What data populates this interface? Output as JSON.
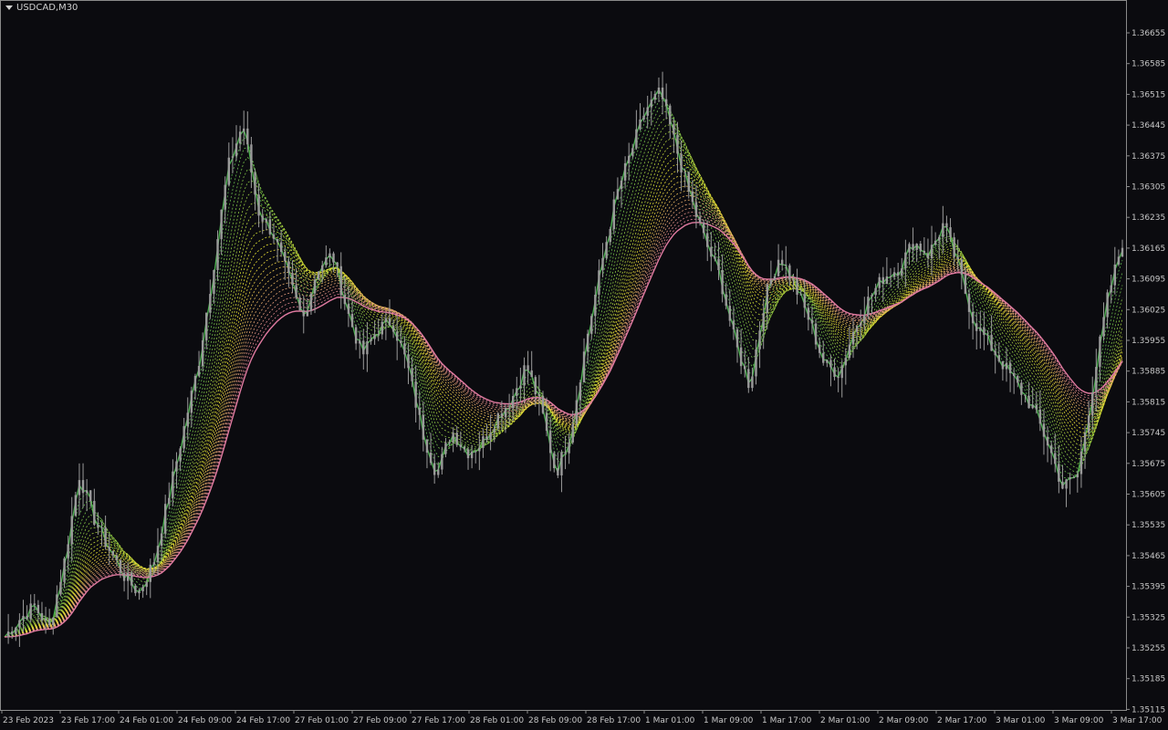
{
  "window": {
    "symbol_timeframe": "USDCAD,M30"
  },
  "colors": {
    "background": "#0b0b0f",
    "candle": "#9a9a9a",
    "axis": "#c8c8c8",
    "ribbon_fast": "#4caf50",
    "ribbon_mid": "#e8e030",
    "ribbon_slow": "#e07aa0"
  },
  "chart_data": {
    "type": "candlestick",
    "y_ticks": [
      "1.36655",
      "1.36585",
      "1.36515",
      "1.36445",
      "1.36375",
      "1.36305",
      "1.36235",
      "1.36165",
      "1.36095",
      "1.36025",
      "1.35955",
      "1.35885",
      "1.35815",
      "1.35745",
      "1.35675",
      "1.35605",
      "1.35535",
      "1.35465",
      "1.35395",
      "1.35325",
      "1.35255",
      "1.35185",
      "1.35115"
    ],
    "ylim": [
      1.35115,
      1.36705
    ],
    "x_ticks": [
      "23 Feb 2023",
      "23 Feb 17:00",
      "24 Feb 01:00",
      "24 Feb 09:00",
      "24 Feb 17:00",
      "27 Feb 01:00",
      "27 Feb 09:00",
      "27 Feb 17:00",
      "28 Feb 01:00",
      "28 Feb 09:00",
      "28 Feb 17:00",
      "1 Mar 01:00",
      "1 Mar 09:00",
      "1 Mar 17:00",
      "2 Mar 01:00",
      "2 Mar 09:00",
      "2 Mar 17:00",
      "3 Mar 01:00",
      "3 Mar 09:00",
      "3 Mar 17:00"
    ],
    "price_path": [
      1.3528,
      1.3532,
      1.3535,
      1.353,
      1.3545,
      1.3565,
      1.3555,
      1.3548,
      1.3542,
      1.3538,
      1.3545,
      1.356,
      1.3575,
      1.359,
      1.3612,
      1.3635,
      1.3645,
      1.3625,
      1.362,
      1.361,
      1.36,
      1.3612,
      1.3615,
      1.3602,
      1.3592,
      1.3598,
      1.36,
      1.359,
      1.3575,
      1.3565,
      1.3575,
      1.357,
      1.3572,
      1.3578,
      1.3582,
      1.359,
      1.358,
      1.3565,
      1.3575,
      1.3595,
      1.3612,
      1.3628,
      1.3638,
      1.3648,
      1.3652,
      1.364,
      1.3628,
      1.3618,
      1.361,
      1.3595,
      1.3585,
      1.3605,
      1.3615,
      1.3608,
      1.36,
      1.359,
      1.3588,
      1.3598,
      1.3605,
      1.361,
      1.3612,
      1.3618,
      1.3615,
      1.3622,
      1.3612,
      1.36,
      1.3595,
      1.359,
      1.3585,
      1.358,
      1.3572,
      1.3562,
      1.3565,
      1.3585,
      1.3605,
      1.3618
    ]
  }
}
